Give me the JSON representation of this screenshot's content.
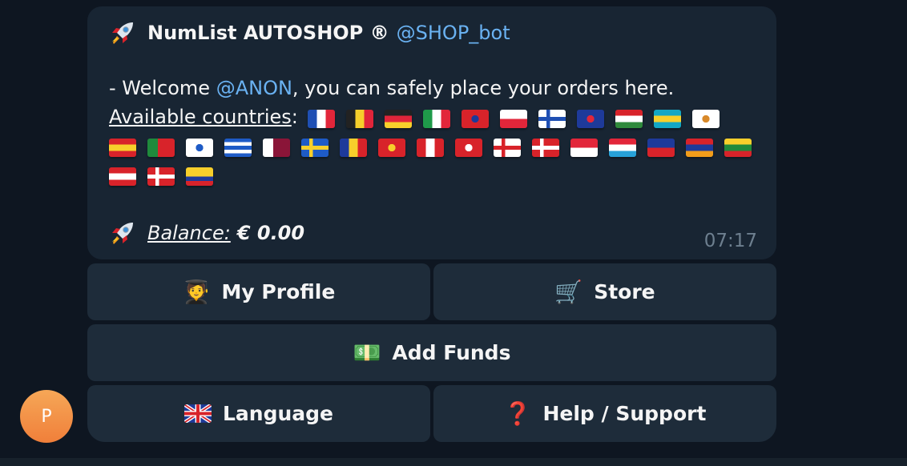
{
  "message": {
    "bot_name": "NumList AUTOSHOP ®",
    "bot_username": "@SHOP_bot",
    "welcome_prefix": "- Welcome ",
    "welcome_mention": "@ANON",
    "welcome_suffix": ", you can safely place your orders here.",
    "countries_label": "Available countries",
    "countries_colon": ":",
    "balance_label": "Balance:",
    "balance_value": "€ 0.00",
    "time": "07:17",
    "rocket_icon": "rocket-icon"
  },
  "flags": [
    {
      "name": "france",
      "colors": [
        "#1f4fb3",
        "#ffffff",
        "#e2263a"
      ],
      "dir": "v"
    },
    {
      "name": "belgium",
      "colors": [
        "#222222",
        "#f7cf2b",
        "#e0253a"
      ],
      "dir": "v"
    },
    {
      "name": "germany",
      "colors": [
        "#222222",
        "#e0253a",
        "#f7cf2b"
      ],
      "dir": "h"
    },
    {
      "name": "italy",
      "colors": [
        "#1f9a4a",
        "#ffffff",
        "#e2263a"
      ],
      "dir": "v"
    },
    {
      "name": "taiwan",
      "colors": [
        "#d8232a",
        "#1e3a9a"
      ],
      "dir": "special"
    },
    {
      "name": "poland",
      "colors": [
        "#ffffff",
        "#e2263a"
      ],
      "dir": "h"
    },
    {
      "name": "finland",
      "colors": [
        "#ffffff",
        "#1f4fb3"
      ],
      "dir": "cross"
    },
    {
      "name": "australia",
      "colors": [
        "#1e3a9a",
        "#e2263a"
      ],
      "dir": "special"
    },
    {
      "name": "hungary",
      "colors": [
        "#d8232a",
        "#ffffff",
        "#2f8a3c"
      ],
      "dir": "h"
    },
    {
      "name": "bahamas",
      "colors": [
        "#13a7c5",
        "#f7cf2b",
        "#13a7c5"
      ],
      "dir": "h"
    },
    {
      "name": "cyprus",
      "colors": [
        "#ffffff",
        "#d8892a"
      ],
      "dir": "special"
    },
    {
      "name": "spain",
      "colors": [
        "#d8232a",
        "#f7cf2b",
        "#d8232a"
      ],
      "dir": "h"
    },
    {
      "name": "portugal",
      "colors": [
        "#1f8a3c",
        "#d8232a"
      ],
      "dir": "v2"
    },
    {
      "name": "israel",
      "colors": [
        "#ffffff",
        "#1e5bc6"
      ],
      "dir": "special"
    },
    {
      "name": "greece",
      "colors": [
        "#1e5bc6",
        "#ffffff",
        "#1e5bc6",
        "#ffffff",
        "#1e5bc6"
      ],
      "dir": "h"
    },
    {
      "name": "qatar",
      "colors": [
        "#ffffff",
        "#8a1538"
      ],
      "dir": "v2"
    },
    {
      "name": "sweden",
      "colors": [
        "#1e5bc6",
        "#f7cf2b"
      ],
      "dir": "cross"
    },
    {
      "name": "romania",
      "colors": [
        "#1e3a9a",
        "#f7cf2b",
        "#d8232a"
      ],
      "dir": "v"
    },
    {
      "name": "vietnam",
      "colors": [
        "#d8232a",
        "#f7cf2b"
      ],
      "dir": "special"
    },
    {
      "name": "canada",
      "colors": [
        "#d8232a",
        "#ffffff",
        "#d8232a"
      ],
      "dir": "v"
    },
    {
      "name": "switzerland",
      "colors": [
        "#d8232a",
        "#ffffff"
      ],
      "dir": "special"
    },
    {
      "name": "georgia",
      "colors": [
        "#ffffff",
        "#d8232a"
      ],
      "dir": "cross"
    },
    {
      "name": "denmark",
      "colors": [
        "#d8232a",
        "#ffffff"
      ],
      "dir": "cross"
    },
    {
      "name": "singapore",
      "colors": [
        "#e2263a",
        "#ffffff"
      ],
      "dir": "h"
    },
    {
      "name": "luxembourg",
      "colors": [
        "#e2263a",
        "#ffffff",
        "#27a1d8"
      ],
      "dir": "h"
    },
    {
      "name": "liechtenstein",
      "colors": [
        "#1e3a9a",
        "#d8232a"
      ],
      "dir": "h"
    },
    {
      "name": "armenia",
      "colors": [
        "#d8232a",
        "#1e3a9a",
        "#f29d1a"
      ],
      "dir": "h"
    },
    {
      "name": "lithuania",
      "colors": [
        "#f7cf2b",
        "#1f8a3c",
        "#d8232a"
      ],
      "dir": "h"
    },
    {
      "name": "austria",
      "colors": [
        "#d8232a",
        "#ffffff",
        "#d8232a"
      ],
      "dir": "h"
    },
    {
      "name": "norway",
      "colors": [
        "#d8232a",
        "#ffffff"
      ],
      "dir": "cross"
    },
    {
      "name": "colombia",
      "colors": [
        "#f7cf2b",
        "#f7cf2b",
        "#1e3a9a",
        "#d8232a"
      ],
      "dir": "h"
    }
  ],
  "keyboard": {
    "profile": {
      "label": "My Profile",
      "icon": "student-icon",
      "glyph": "🧑‍🎓"
    },
    "store": {
      "label": "Store",
      "icon": "cart-icon",
      "glyph": "🛒"
    },
    "funds": {
      "label": "Add Funds",
      "icon": "money-icon",
      "glyph": "💵"
    },
    "language": {
      "label": "Language",
      "icon": "uk-flag-icon",
      "glyph": "🇬🇧"
    },
    "help": {
      "label": "Help / Support",
      "icon": "question-icon",
      "glyph": "❓"
    }
  },
  "avatar": {
    "initial": "P",
    "color": "#f39a4b"
  }
}
